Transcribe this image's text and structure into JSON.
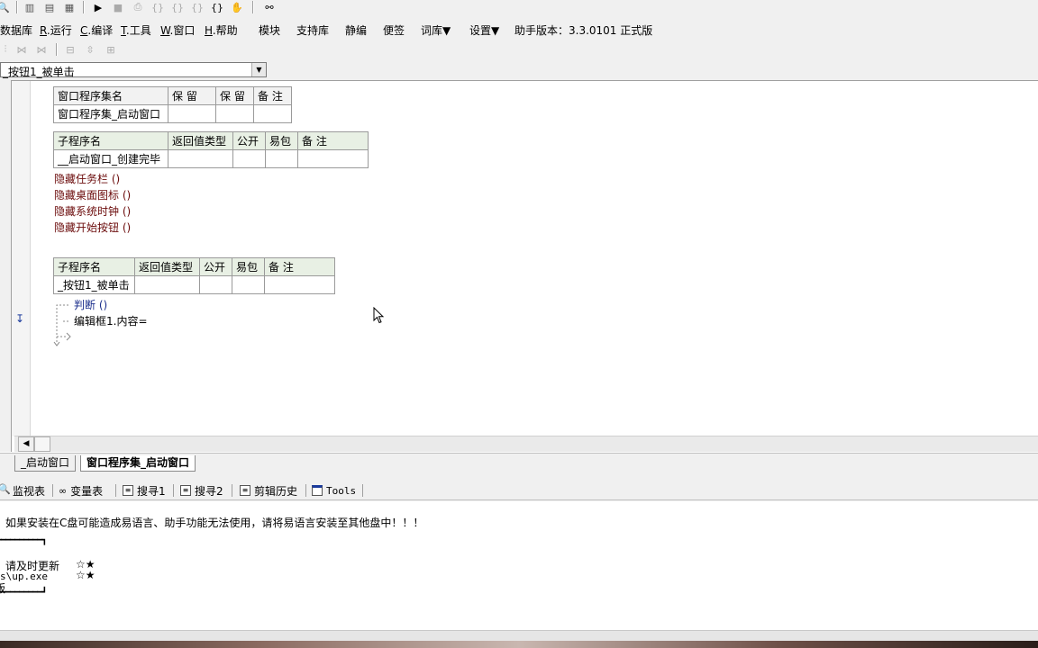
{
  "menu": {
    "items": [
      {
        "label": "数据库"
      },
      {
        "key": "R",
        "label": ".运行"
      },
      {
        "key": "C",
        "label": ".编译"
      },
      {
        "key": "T",
        "label": ".工具"
      },
      {
        "key": "W",
        "label": ".窗口"
      },
      {
        "key": "H",
        "label": ".帮助"
      },
      {
        "label": "模块"
      },
      {
        "label": "支持库"
      },
      {
        "label": "静编"
      },
      {
        "label": "便签"
      },
      {
        "label": "词库▼"
      },
      {
        "label": "设置▼"
      }
    ],
    "version_text": "助手版本：3.3.0101 正式版"
  },
  "combo": {
    "value": "_按钮1_被单击"
  },
  "editor": {
    "assembly_table": {
      "headers": [
        "窗口程序集名",
        "保 留",
        "保 留",
        "备 注"
      ],
      "row": [
        "窗口程序集_启动窗口",
        "",
        "",
        ""
      ]
    },
    "sub1": {
      "headers": [
        "子程序名",
        "返回值类型",
        "公开",
        "易包",
        "备 注"
      ],
      "row": [
        "__启动窗口_创建完毕",
        "",
        "",
        "",
        ""
      ],
      "lines": [
        "隐藏任务栏 ()",
        "隐藏桌面图标 ()",
        "隐藏系统时钟 ()",
        "隐藏开始按钮 ()"
      ]
    },
    "sub2": {
      "headers": [
        "子程序名",
        "返回值类型",
        "公开",
        "易包",
        "备 注"
      ],
      "row": [
        "_按钮1_被单击",
        "",
        "",
        "",
        ""
      ],
      "lines": [
        "判断 ()",
        "编辑框1.内容="
      ]
    }
  },
  "file_tabs": [
    {
      "label": "_启动窗口",
      "active": false
    },
    {
      "label": "窗口程序集_启动窗口",
      "active": true
    }
  ],
  "panel_tabs": [
    {
      "label": "监视表",
      "icon": "magnifier-icon"
    },
    {
      "label": "变量表",
      "icon": "glasses-icon"
    },
    {
      "label": "搜寻1",
      "icon": "search-doc-icon"
    },
    {
      "label": "搜寻2",
      "icon": "search-doc-icon"
    },
    {
      "label": "剪辑历史",
      "icon": "clipboard-icon"
    },
    {
      "label": "Tools",
      "icon": "window-icon"
    }
  ],
  "output": {
    "warning": "如果安装在C盘可能造成易语言、助手功能无法使用，请将易语言安装至其他盘中！！！",
    "box_top": "━━━━━━━━━━┓",
    "line1": "请及时更新",
    "stars1": "☆★",
    "line2": "s\\up.exe",
    "stars2": "☆★",
    "line3": "版",
    "box_bottom": "━━━━━━━━━━┛"
  },
  "colors": {
    "header_green": "#e8f0e4",
    "code_red": "#6b0b0b",
    "code_blue": "#1a2e8c"
  }
}
